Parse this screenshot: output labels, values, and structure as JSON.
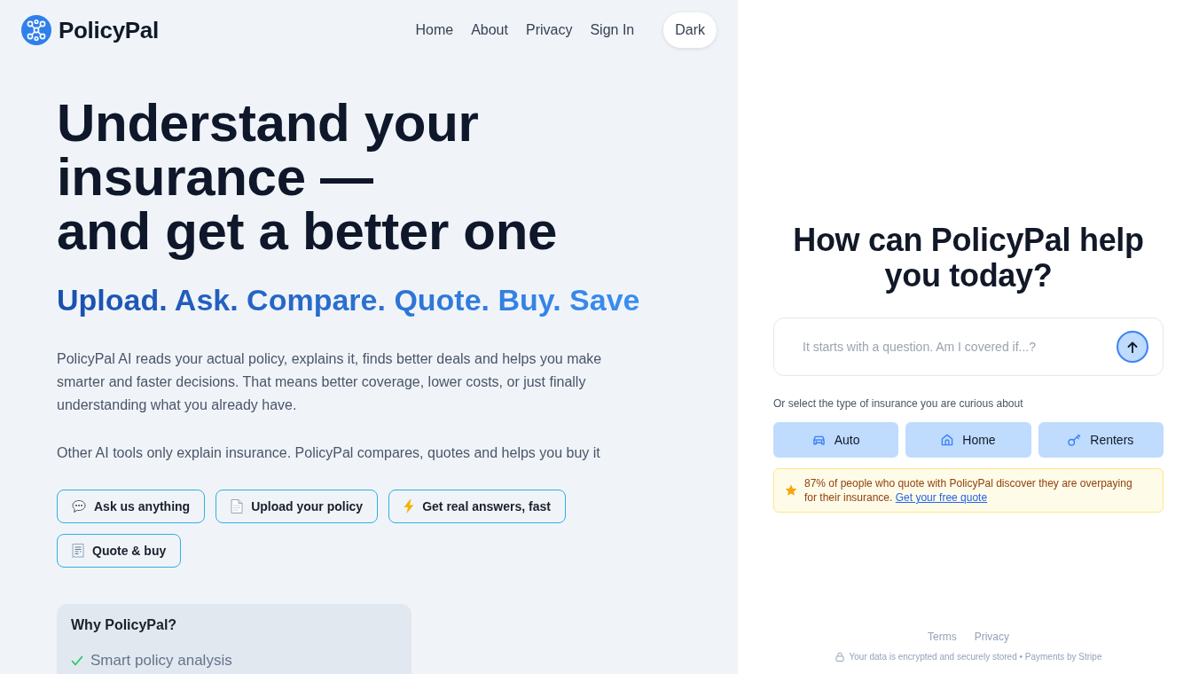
{
  "header": {
    "brand": "PolicyPal",
    "nav_links": [
      "Home",
      "About",
      "Privacy",
      "Sign In"
    ],
    "theme_button": "Dark"
  },
  "hero": {
    "headline_lines": [
      "Understand your insurance —",
      "and get a better one"
    ],
    "tagline": "Upload. Ask. Compare. Quote. Buy. Save",
    "paragraphs": [
      "PolicyPal AI reads your actual policy, explains it, finds better deals and helps you make smarter and faster decisions. That means better coverage, lower costs, or just finally understanding what you already have.",
      "Other AI tools only explain insurance. PolicyPal compares, quotes and helps you buy it"
    ],
    "features": [
      {
        "label": "Ask us anything",
        "kind": "chat"
      },
      {
        "label": "Upload your policy",
        "kind": "document"
      },
      {
        "label": "Get real answers, fast",
        "kind": "bolt"
      },
      {
        "label": "Quote & buy",
        "kind": "receipt"
      }
    ]
  },
  "why_card": {
    "title": "Why PolicyPal?",
    "items": [
      "Smart policy analysis"
    ]
  },
  "assistant": {
    "title": "How can PolicyPal help you today?",
    "question": {
      "placeholder": "It starts with a question. Am I covered if...?"
    },
    "prompt": "Or select the type of insurance you are curious about",
    "insurance_types": [
      {
        "label": "Auto",
        "kind": "car"
      },
      {
        "label": "Home",
        "kind": "house"
      },
      {
        "label": "Renters",
        "kind": "key"
      }
    ],
    "notice": {
      "text": "87% of people who quote with PolicyPal discover they are overpaying for their insurance.",
      "link": "Get your free quote"
    }
  },
  "footer": {
    "links": [
      "Terms",
      "Privacy"
    ],
    "security_note": "Your data is encrypted and securely stored • Payments by Stripe"
  }
}
